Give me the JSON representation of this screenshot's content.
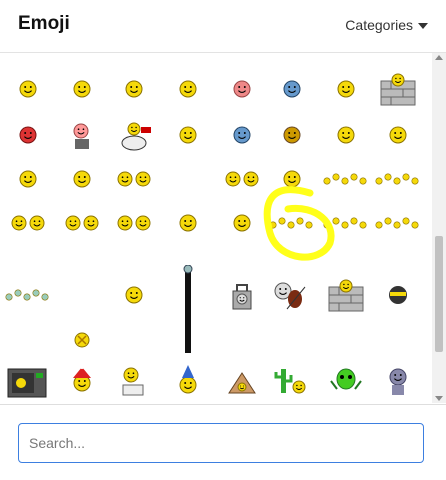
{
  "header": {
    "title": "Emoji",
    "categories_label": "Categories"
  },
  "search": {
    "placeholder": "Search...",
    "value": ""
  },
  "colors": {
    "smiley": "#f5d90a",
    "smiley_edge": "#8a7200",
    "highlight": "#ffff1a",
    "focus": "#3d7fe0"
  },
  "emoji_cells": [
    "singing-smiley-icon",
    "cap-smiley-icon",
    "music-note-smiley-icon",
    "alien-smiley-icon",
    "sick-smiley-icon",
    "blue-sad-smiley-icon",
    "sad-smiley-icon",
    "brick-wall-smiley-icon",
    "angry-red-smiley-icon",
    "pink-pot-smiley-icon",
    "drummer-smiley-icon",
    "worried-smiley-icon",
    "blue-face-icon",
    "brown-face-icon",
    "sleepy-smiley-icon",
    "zzz-smiley-icon",
    "waving-smiley-icon",
    "scratching-head-smiley-icon",
    "dancing-smilies-icon",
    "whistling-smiley-icon",
    "jumping-smiley-icon",
    "group-smilies-icon",
    "pointing-smilies-icon",
    "two-smilies-icon",
    "two-friends-icon",
    "pair-smilies-icon",
    "bubbles-smiley-icon",
    "banana-smiley-icon",
    "mini-band-icon",
    "tiny-smilies-row-icon",
    "tiny-smilies-row-2-icon",
    "crawling-smilies-icon",
    "stretch-smiley-icon",
    "stick-smiley-icon",
    "locker-smiley-icon",
    "violin-smiley-icon",
    "wall-smiley-icon",
    "ninja-smiley-icon",
    "x-face-smiley-icon",
    "microwave-icon",
    "santa-hat-smiley-icon",
    "toilet-smiley-icon",
    "party-hat-smiley-icon",
    "camping-smiley-icon",
    "cactus-smiley-icon",
    "alien-green-icon",
    "blue-robot-icon"
  ]
}
